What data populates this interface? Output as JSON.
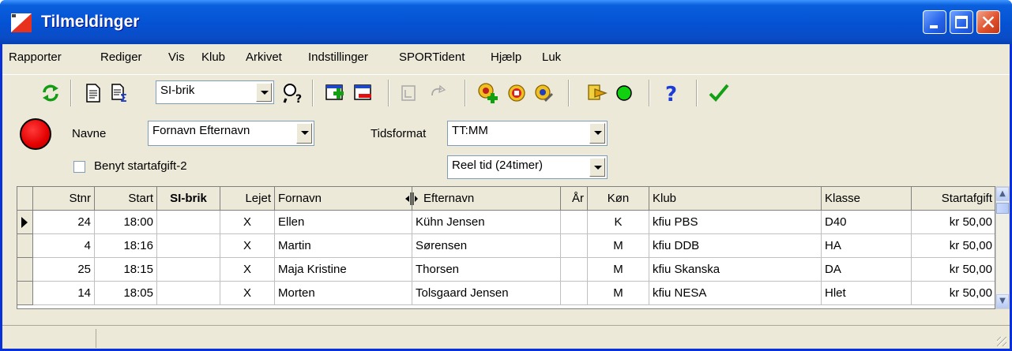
{
  "window": {
    "title": "Tilmeldinger"
  },
  "menu": [
    "Rapporter",
    "Rediger",
    "Vis",
    "Klub",
    "Arkivet",
    "Indstillinger",
    "SPORTident",
    "Hjælp",
    "Luk"
  ],
  "toolbar": {
    "combo_value": "SI-brik",
    "icons": [
      "refresh-icon",
      "document-icon",
      "document-sum-icon",
      "search-help-icon",
      "add-window-icon",
      "remove-window-icon",
      "disabled-window-icon",
      "disabled-refresh-icon",
      "add-runner-icon",
      "stop-icon",
      "edit-runner-icon",
      "export-icon",
      "green-circle-icon",
      "help-icon",
      "checkmark-icon"
    ]
  },
  "options": {
    "names_label": "Navne",
    "names_value": "Fornavn Efternavn",
    "timeformat_label": "Tidsformat",
    "timeformat_value": "TT:MM",
    "clock_value": "Reel tid (24timer)",
    "fee2_label": "Benyt startafgift-2"
  },
  "colors": {
    "status_red": "#e40000",
    "title_blue": "#0452d3"
  },
  "grid": {
    "columns": [
      "Stnr",
      "Start",
      "SI-brik",
      "Lejet",
      "Fornavn",
      "Efternavn",
      "År",
      "Køn",
      "Klub",
      "Klasse",
      "Startafgift"
    ],
    "rows": [
      [
        "24",
        "18:00",
        "",
        "X",
        "Ellen",
        "Kühn Jensen",
        "",
        "K",
        "kfiu PBS",
        "D40",
        "kr 50,00"
      ],
      [
        "4",
        "18:16",
        "",
        "X",
        "Martin",
        "Sørensen",
        "",
        "M",
        "kfiu DDB",
        "HA",
        "kr 50,00"
      ],
      [
        "25",
        "18:15",
        "",
        "X",
        "Maja Kristine",
        "Thorsen",
        "",
        "M",
        "kfiu Skanska",
        "DA",
        "kr 50,00"
      ],
      [
        "14",
        "18:05",
        "",
        "X",
        "Morten",
        "Tolsgaard Jensen",
        "",
        "M",
        "kfiu NESA",
        "Hlet",
        "kr 50,00"
      ]
    ]
  }
}
